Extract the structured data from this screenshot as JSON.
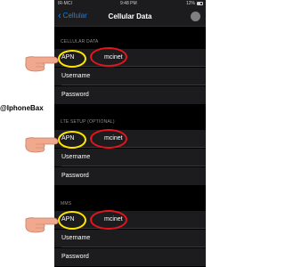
{
  "status_bar": {
    "carrier": "IR-MCI",
    "time": "9:48 PM",
    "battery": "12%"
  },
  "nav": {
    "back_label": "Cellular",
    "title": "Cellular Data"
  },
  "sections": [
    {
      "header": "CELLULAR DATA",
      "rows": [
        {
          "label": "APN",
          "value": "mcinet"
        },
        {
          "label": "Username",
          "value": ""
        },
        {
          "label": "Password",
          "value": ""
        }
      ]
    },
    {
      "header": "LTE SETUP (OPTIONAL)",
      "rows": [
        {
          "label": "APN",
          "value": "mcinet"
        },
        {
          "label": "Username",
          "value": ""
        },
        {
          "label": "Password",
          "value": ""
        }
      ]
    },
    {
      "header": "MMS",
      "rows": [
        {
          "label": "APN",
          "value": "mcinet"
        },
        {
          "label": "Username",
          "value": ""
        },
        {
          "label": "Password",
          "value": ""
        }
      ]
    }
  ],
  "watermark": "@IphoneBax",
  "colors": {
    "accent": "#0a84ff",
    "highlight_yellow": "#ffe600",
    "highlight_red": "#e8141b",
    "background": "#000000",
    "cell": "#1c1c1e"
  }
}
